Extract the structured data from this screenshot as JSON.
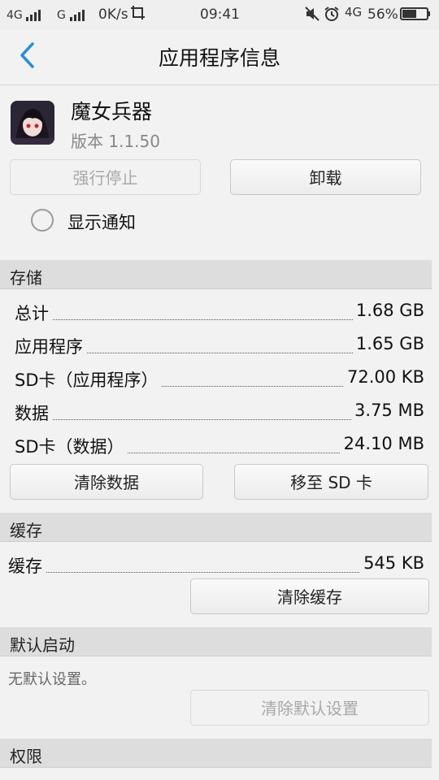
{
  "status_bar": {
    "net1": "4G",
    "net2": "G",
    "speed": "0K/s",
    "time": "09:41",
    "net3": "4G",
    "battery": "56%"
  },
  "header": {
    "title": "应用程序信息"
  },
  "app": {
    "name": "魔女兵器",
    "version": "版本 1.1.50"
  },
  "actions": {
    "force_stop": "强行停止",
    "uninstall": "卸载"
  },
  "notify": {
    "label": "显示通知"
  },
  "storage": {
    "header": "存储",
    "rows": [
      {
        "key": "总计",
        "value": "1.68 GB"
      },
      {
        "key": "应用程序",
        "value": "1.65 GB"
      },
      {
        "key": "SD卡（应用程序）",
        "value": "72.00 KB"
      },
      {
        "key": "数据",
        "value": "3.75 MB"
      },
      {
        "key": "SD卡（数据）",
        "value": "24.10 MB"
      }
    ],
    "clear_data": "清除数据",
    "move_sd": "移至 SD 卡"
  },
  "cache": {
    "header": "缓存",
    "key": "缓存",
    "value": "545 KB",
    "clear_cache": "清除缓存"
  },
  "defaults": {
    "header": "默认启动",
    "none_text": "无默认设置。",
    "clear_defaults": "清除默认设置"
  },
  "permissions": {
    "header": "权限"
  }
}
